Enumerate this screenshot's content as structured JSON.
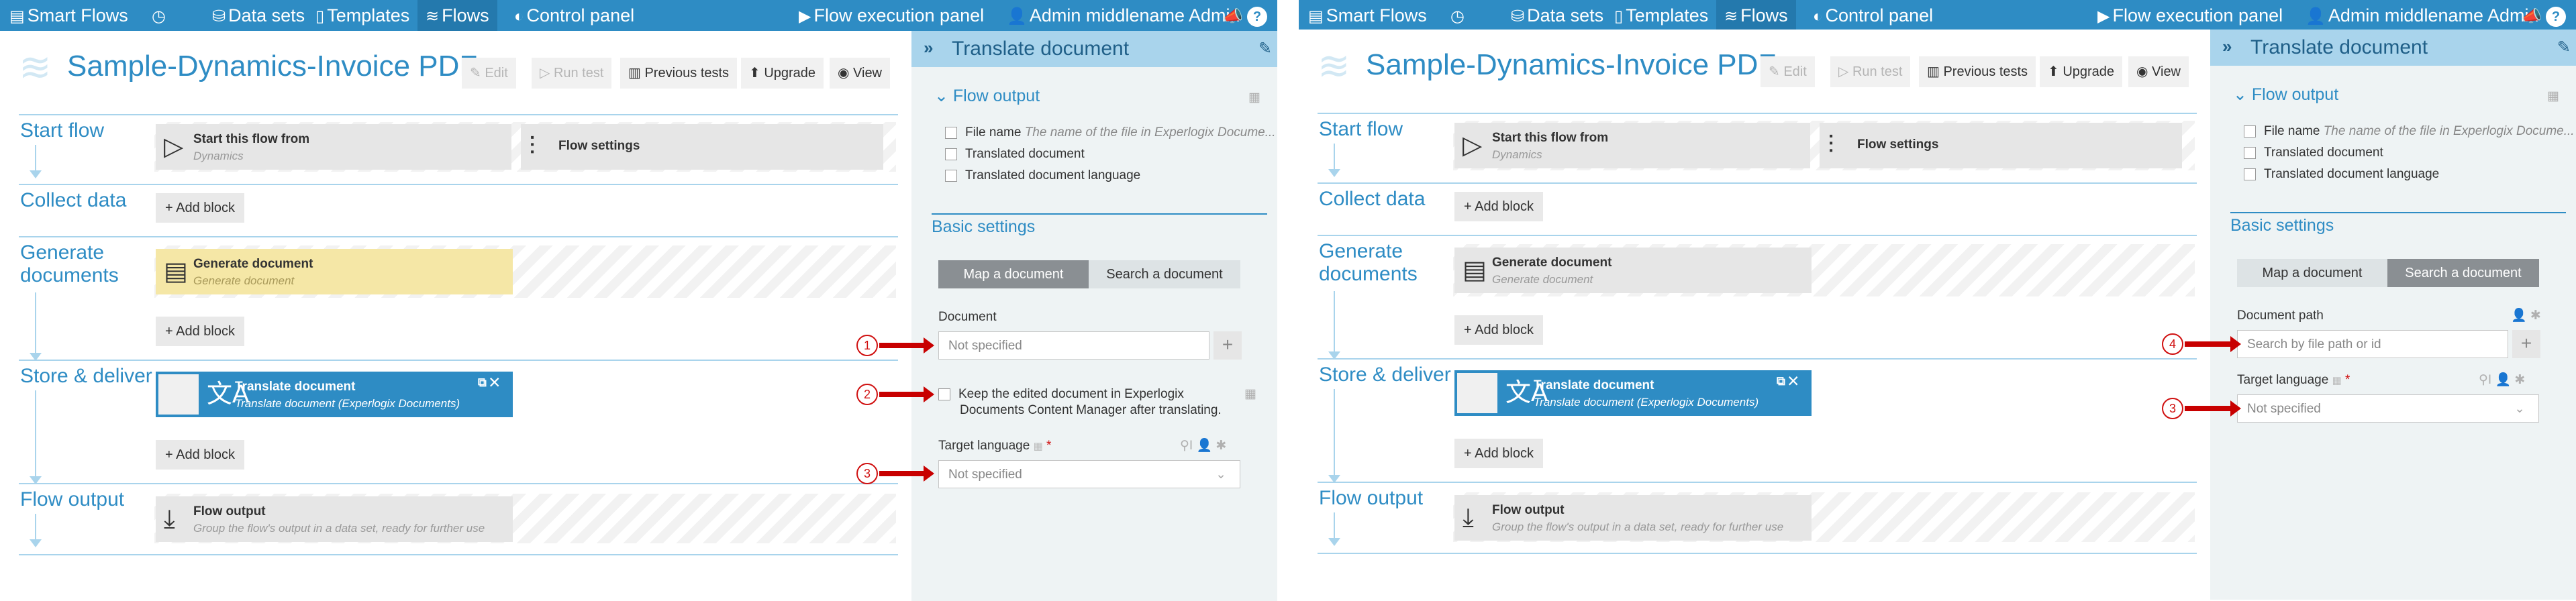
{
  "nav": {
    "brand": "Smart Flows",
    "history_icon": "history-icon",
    "datasets": "Data sets",
    "templates": "Templates",
    "flows": "Flows",
    "control_panel": "Control panel",
    "flow_execution_panel": "Flow execution panel",
    "user": "Admin middlename Admin",
    "help": "?"
  },
  "page": {
    "title": "Sample-Dynamics-Invoice PDF ...",
    "toolbar": {
      "edit": "Edit",
      "run_test": "Run test",
      "previous_tests": "Previous tests",
      "upgrade": "Upgrade",
      "view": "View"
    }
  },
  "stages": {
    "start": "Start flow",
    "collect": "Collect data",
    "generate_line1": "Generate",
    "generate_line2": "documents",
    "store": "Store & deliver",
    "output": "Flow output"
  },
  "blocks": {
    "start_from_title": "Start this flow from",
    "start_from_sub": "Dynamics",
    "flow_settings": "Flow settings",
    "add_block": "Add block",
    "generate_title": "Generate document",
    "generate_sub": "Generate document",
    "translate_title": "Translate document",
    "translate_sub": "Translate document (Experlogix Documents)",
    "output_title": "Flow output",
    "output_sub": "Group the flow's output in a data set, ready for further use"
  },
  "panel": {
    "title": "Translate document",
    "flow_output_section": "Flow output",
    "file_name": "File name",
    "file_name_hint": "The name of the file in Experlogix Docume...",
    "translated_document": "Translated document",
    "translated_document_language": "Translated document language",
    "basic_settings": "Basic settings",
    "map_document": "Map a document",
    "search_document": "Search a document",
    "document_label": "Document",
    "document_value": "Not specified",
    "keep_line1": "Keep the edited document in Experlogix",
    "keep_line2": "Documents Content Manager after translating.",
    "target_language": "Target language",
    "target_language_value": "Not specified",
    "document_path_label": "Document path",
    "document_path_placeholder": "Search by file path or id",
    "required_mark": "*"
  },
  "callouts": {
    "one": "1",
    "two": "2",
    "three": "3",
    "four": "4"
  },
  "colors": {
    "accent": "#2e8cc4",
    "panel_header": "#a9d4ec",
    "generate_block": "#f5e7a6",
    "callout": "#c80000"
  }
}
